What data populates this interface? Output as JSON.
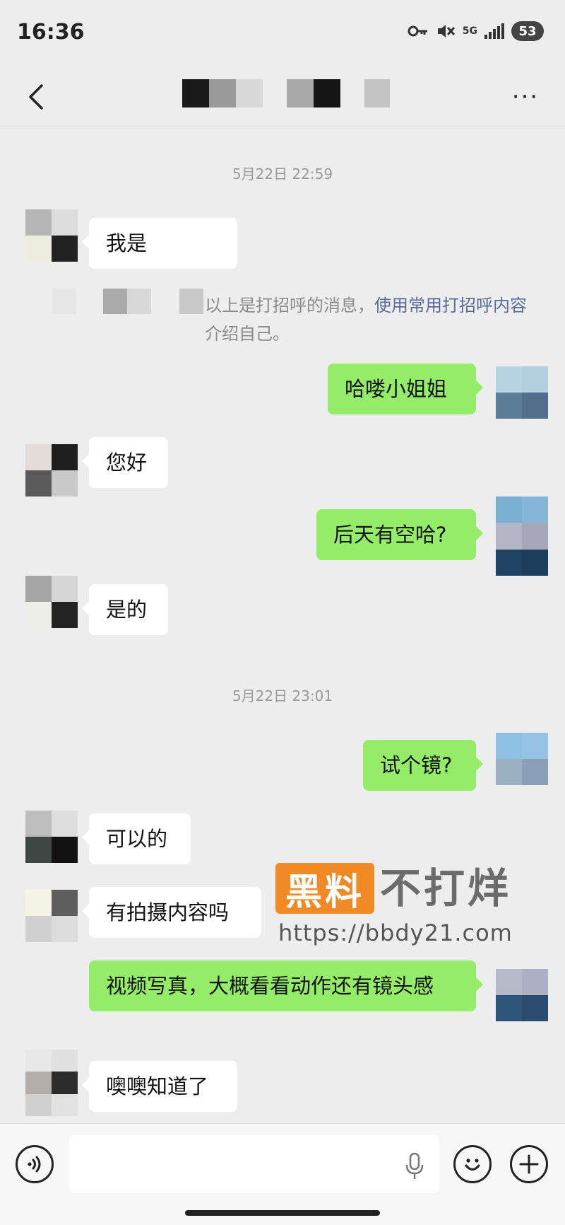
{
  "status_bar": {
    "time": "16:36",
    "network": "5G",
    "battery": "53",
    "icons": [
      "key-icon",
      "mute-icon",
      "signal-icon"
    ]
  },
  "header": {
    "back_icon": "chevron-left-icon",
    "more_icon": "more-dots-icon",
    "more_label": "···"
  },
  "timestamps": [
    "5月22日 22:59",
    "5月22日 23:01"
  ],
  "messages": [
    {
      "side": "in",
      "text": "我是"
    },
    {
      "side": "out",
      "text": "哈喽小姐姐"
    },
    {
      "side": "in",
      "text": "您好"
    },
    {
      "side": "out",
      "text": "后天有空哈?"
    },
    {
      "side": "in",
      "text": "是的"
    },
    {
      "side": "out",
      "text": "试个镜?"
    },
    {
      "side": "in",
      "text": "可以的"
    },
    {
      "side": "in",
      "text": "有拍摄内容吗"
    },
    {
      "side": "out",
      "text": "视频写真，大概看看动作还有镜头感"
    },
    {
      "side": "in",
      "text": "噢噢知道了"
    }
  ],
  "system_note": {
    "prefix": "以上是打招呼的消息，",
    "link": "使用常用打招呼内容",
    "suffix": "介绍自己。"
  },
  "watermark": {
    "badge": "黑料",
    "text": "不打烊",
    "url": "https://bbdy21.com"
  },
  "input_bar": {
    "placeholder": "",
    "voice_icon": "voice-icon",
    "emoji_icon": "emoji-icon",
    "plus_icon": "plus-icon"
  },
  "colors": {
    "background": "#ededed",
    "outgoing_bubble": "#95ec69",
    "incoming_bubble": "#ffffff",
    "link": "#576b95",
    "watermark_badge": "#f08a24"
  }
}
